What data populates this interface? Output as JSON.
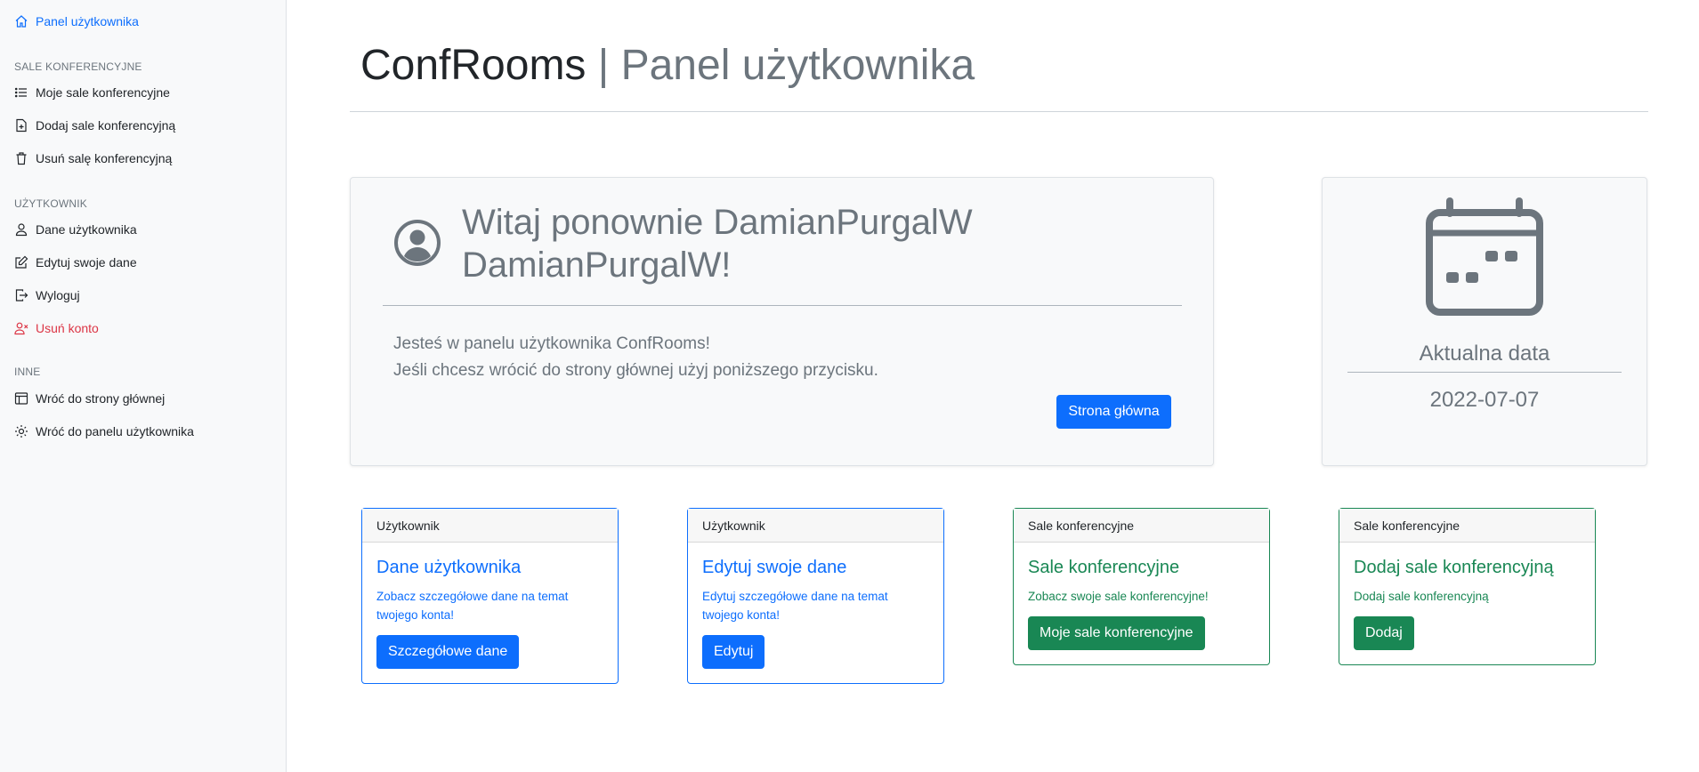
{
  "sidebar": {
    "top_item": "Panel użytkownika",
    "sections": [
      {
        "heading": "SALE KONFERENCYJNE",
        "items": [
          "Moje sale konferencyjne",
          "Dodaj sale konferencyjną",
          "Usuń salę konferencyjną"
        ]
      },
      {
        "heading": "UŻYTKOWNIK",
        "items": [
          "Dane użytkownika",
          "Edytuj swoje dane",
          "Wyloguj",
          "Usuń konto"
        ]
      },
      {
        "heading": "INNE",
        "items": [
          "Wróć do strony głównej",
          "Wróć do panelu użytkownika"
        ]
      }
    ]
  },
  "header": {
    "brand": "ConfRooms",
    "separator": "|",
    "subtitle": "Panel użytkownika"
  },
  "welcome": {
    "heading": "Witaj ponownie DamianPurgalW DamianPurgalW!",
    "line1": "Jesteś w panelu użytkownika ConfRooms!",
    "line2": "Jeśli chcesz wrócić do strony głównej użyj poniższego przycisku.",
    "button": "Strona główna"
  },
  "date_card": {
    "label": "Aktualna data",
    "value": "2022-07-07"
  },
  "cards": [
    {
      "header": "Użytkownik",
      "title": "Dane użytkownika",
      "text": "Zobacz szczegółowe dane na temat twojego konta!",
      "button": "Szczegółowe dane"
    },
    {
      "header": "Użytkownik",
      "title": "Edytuj swoje dane",
      "text": "Edytuj szczegółowe dane na temat twojego konta!",
      "button": "Edytuj"
    },
    {
      "header": "Sale konferencyjne",
      "title": "Sale konferencyjne",
      "text": "Zobacz swoje sale konferencyjne!",
      "button": "Moje sale konferencyjne"
    },
    {
      "header": "Sale konferencyjne",
      "title": "Dodaj sale konferencyjną",
      "text": "Dodaj sale konferencyjną",
      "button": "Dodaj"
    }
  ],
  "colors": {
    "primary": "#0d6efd",
    "success": "#198754",
    "danger": "#dc3545",
    "muted": "#6c757d"
  }
}
